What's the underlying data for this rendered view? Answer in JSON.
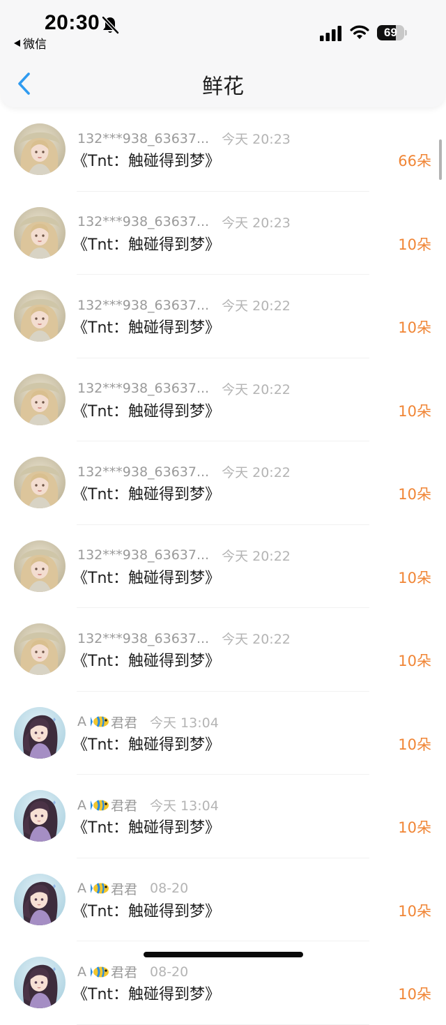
{
  "status_bar": {
    "time": "20:30",
    "back_app": "微信",
    "battery": "69",
    "battery_level": 0.69
  },
  "nav": {
    "title": "鲜花"
  },
  "colors": {
    "accent_blue": "#2f9bf0",
    "count_orange": "#f08535"
  },
  "list": [
    {
      "user": "132***938_63637...",
      "has_fish": false,
      "time": "今天 20:23",
      "title": "《Tnt：触碰得到梦》",
      "count": "66朵",
      "avatar": "blonde-portrait"
    },
    {
      "user": "132***938_63637...",
      "has_fish": false,
      "time": "今天 20:23",
      "title": "《Tnt：触碰得到梦》",
      "count": "10朵",
      "avatar": "blonde-portrait"
    },
    {
      "user": "132***938_63637...",
      "has_fish": false,
      "time": "今天 20:22",
      "title": "《Tnt：触碰得到梦》",
      "count": "10朵",
      "avatar": "blonde-portrait"
    },
    {
      "user": "132***938_63637...",
      "has_fish": false,
      "time": "今天 20:22",
      "title": "《Tnt：触碰得到梦》",
      "count": "10朵",
      "avatar": "blonde-portrait"
    },
    {
      "user": "132***938_63637...",
      "has_fish": false,
      "time": "今天 20:22",
      "title": "《Tnt：触碰得到梦》",
      "count": "10朵",
      "avatar": "blonde-portrait"
    },
    {
      "user": "132***938_63637...",
      "has_fish": false,
      "time": "今天 20:22",
      "title": "《Tnt：触碰得到梦》",
      "count": "10朵",
      "avatar": "blonde-portrait"
    },
    {
      "user": "132***938_63637...",
      "has_fish": false,
      "time": "今天 20:22",
      "title": "《Tnt：触碰得到梦》",
      "count": "10朵",
      "avatar": "blonde-portrait"
    },
    {
      "user": "A",
      "has_fish": true,
      "user_suffix": "君君",
      "time": "今天 13:04",
      "title": "《Tnt：触碰得到梦》",
      "count": "10朵",
      "avatar": "anime-girl"
    },
    {
      "user": "A",
      "has_fish": true,
      "user_suffix": "君君",
      "time": "今天 13:04",
      "title": "《Tnt：触碰得到梦》",
      "count": "10朵",
      "avatar": "anime-girl"
    },
    {
      "user": "A",
      "has_fish": true,
      "user_suffix": "君君",
      "time": "08-20",
      "title": "《Tnt：触碰得到梦》",
      "count": "10朵",
      "avatar": "anime-girl"
    },
    {
      "user": "A",
      "has_fish": true,
      "user_suffix": "君君",
      "time": "08-20",
      "title": "《Tnt：触碰得到梦》",
      "count": "10朵",
      "avatar": "anime-girl"
    }
  ]
}
